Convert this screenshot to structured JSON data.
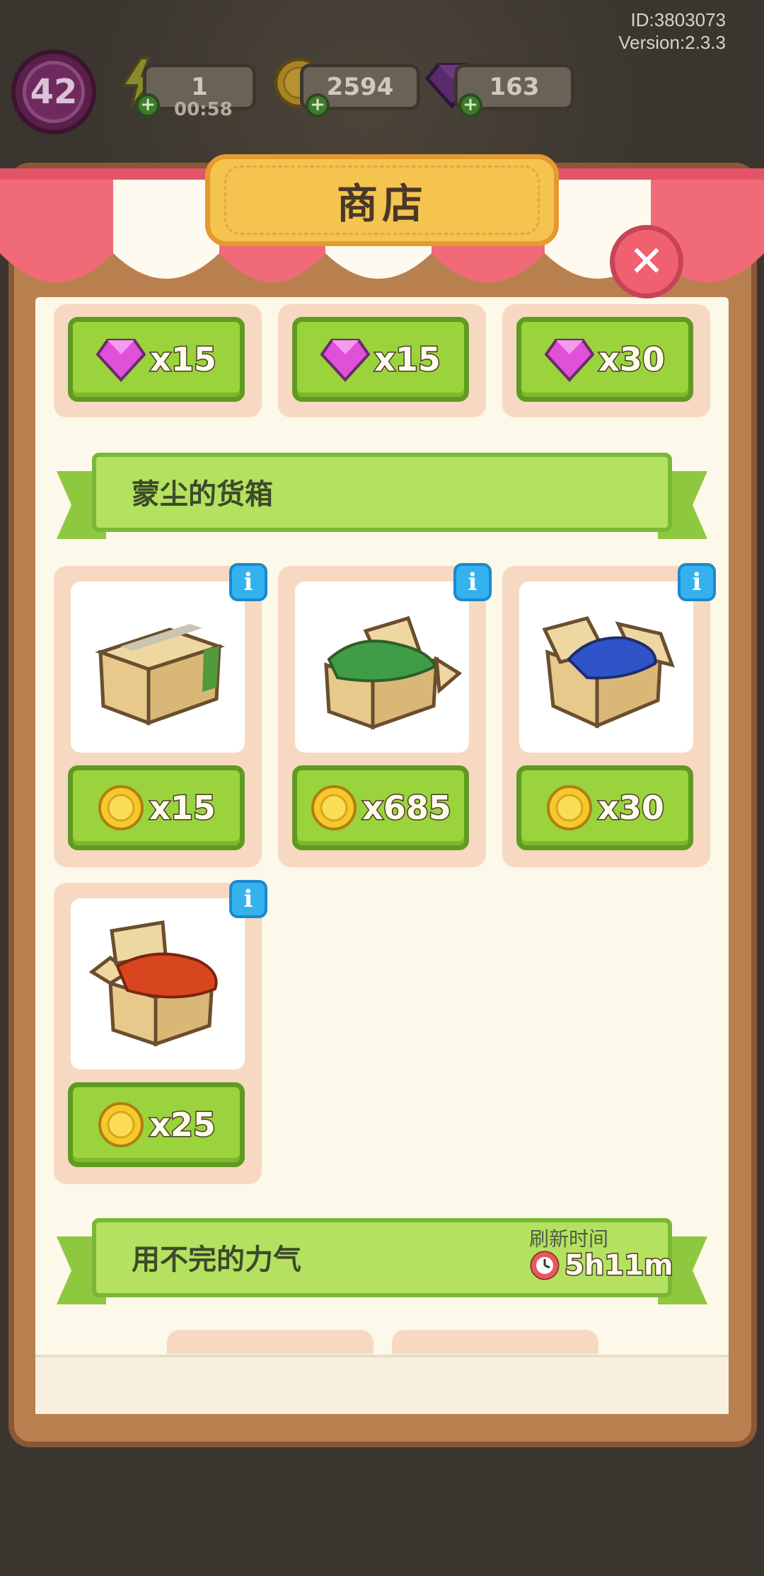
{
  "meta": {
    "id_text": "ID:3803073",
    "version_text": "Version:2.3.3"
  },
  "hud": {
    "level": "42",
    "energy": {
      "value": "1",
      "timer": "00:58",
      "icon": "lightning-icon"
    },
    "coins": {
      "value": "2594",
      "icon": "coin-icon"
    },
    "gems": {
      "value": "163",
      "icon": "gem-icon"
    }
  },
  "shop": {
    "title": "商店",
    "close_icon": "close-icon",
    "top_row": [
      {
        "icon": "gem-icon",
        "price": "x15"
      },
      {
        "icon": "gem-icon",
        "price": "x15"
      },
      {
        "icon": "gem-icon",
        "price": "x30"
      }
    ],
    "section1": {
      "title": "蒙尘的货箱",
      "items": [
        {
          "name": "taped-box",
          "cloth_color": "#4f9a3a",
          "price": "x15",
          "currency": "coin-icon"
        },
        {
          "name": "green-cloth-box",
          "cloth_color": "#3f9d48",
          "price": "x685",
          "currency": "coin-icon"
        },
        {
          "name": "blue-cloth-box",
          "cloth_color": "#2f54c8",
          "price": "x30",
          "currency": "coin-icon"
        },
        {
          "name": "red-cloth-box",
          "cloth_color": "#d8461f",
          "price": "x25",
          "currency": "coin-icon"
        }
      ]
    },
    "section2": {
      "title": "用不完的力气",
      "refresh_label": "刷新时间",
      "refresh_time": "5h11m"
    }
  },
  "colors": {
    "button_green": "#9ad33b",
    "banner_green": "#b5e160",
    "awning_red": "#f06a78",
    "plaque_yellow": "#f4c44e",
    "info_blue": "#35b2ee"
  }
}
